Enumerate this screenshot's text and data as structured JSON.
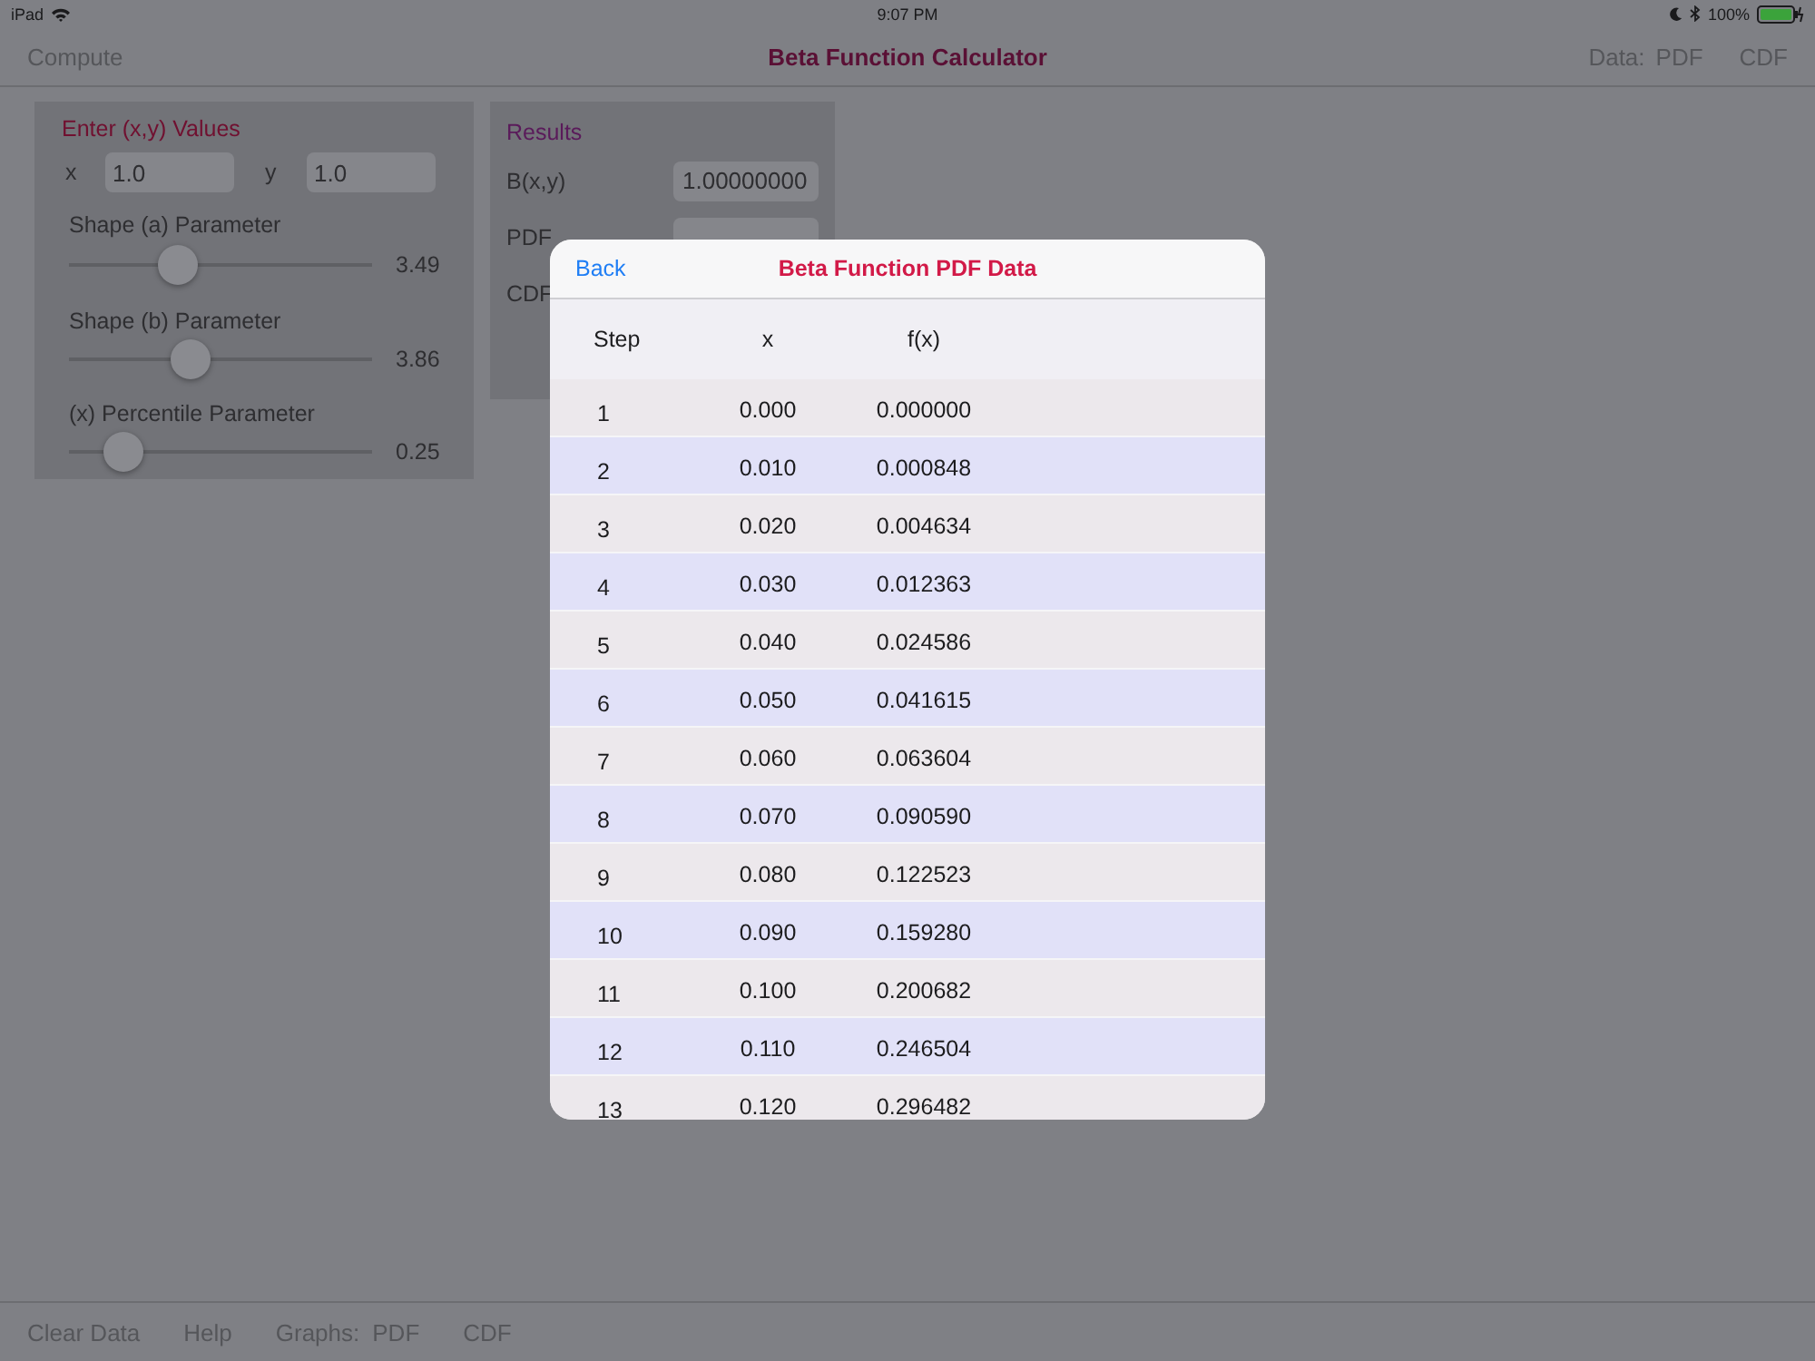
{
  "status_bar": {
    "device": "iPad",
    "time": "9:07 PM",
    "battery": "100%"
  },
  "nav_bar": {
    "left": "Compute",
    "title": "Beta Function Calculator",
    "data_label": "Data:",
    "right_buttons": [
      "PDF",
      "CDF"
    ]
  },
  "inputs": {
    "heading": "Enter (x,y) Values",
    "fields": [
      {
        "label": "x",
        "value": "1.0"
      },
      {
        "label": "y",
        "value": "1.0"
      }
    ],
    "sliders": [
      {
        "label": "Shape (a) Parameter",
        "level": 0.36,
        "reading": "3.49"
      },
      {
        "label": "Shape (b) Parameter",
        "level": 0.4,
        "reading": "3.86"
      },
      {
        "label": "(x) Percentile Parameter",
        "level": 0.18,
        "reading": "0.25"
      }
    ]
  },
  "results": {
    "heading": "Results",
    "rows": [
      {
        "label": "B(x,y)",
        "value": "1.00000000"
      },
      {
        "label": "PDF"
      },
      {
        "label": "CDF"
      }
    ]
  },
  "modal": {
    "back": "Back",
    "title": "Beta Function PDF Data",
    "columns": [
      "Step",
      "x",
      "f(x)"
    ],
    "rows": [
      [
        "1",
        "0.000",
        "0.000000"
      ],
      [
        "2",
        "0.010",
        "0.000848"
      ],
      [
        "3",
        "0.020",
        "0.004634"
      ],
      [
        "4",
        "0.030",
        "0.012363"
      ],
      [
        "5",
        "0.040",
        "0.024586"
      ],
      [
        "6",
        "0.050",
        "0.041615"
      ],
      [
        "7",
        "0.060",
        "0.063604"
      ],
      [
        "8",
        "0.070",
        "0.090590"
      ],
      [
        "9",
        "0.080",
        "0.122523"
      ],
      [
        "10",
        "0.090",
        "0.159280"
      ],
      [
        "11",
        "0.100",
        "0.200682"
      ],
      [
        "12",
        "0.110",
        "0.246504"
      ],
      [
        "13",
        "0.120",
        "0.296482"
      ]
    ]
  },
  "toolbar": {
    "buttons": [
      "Clear Data",
      "Help"
    ],
    "graphs_label": "Graphs:",
    "graph_buttons": [
      "PDF",
      "CDF"
    ]
  }
}
